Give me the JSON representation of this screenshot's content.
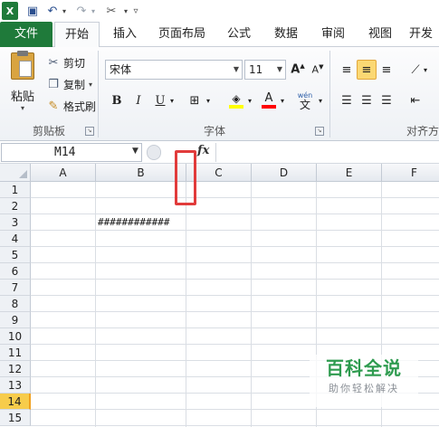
{
  "tabs": [
    "文件",
    "开始",
    "插入",
    "页面布局",
    "公式",
    "数据",
    "审阅",
    "视图",
    "开发"
  ],
  "clipboard": {
    "paste": "粘贴",
    "cut": "剪切",
    "copy": "复制",
    "format_painter": "格式刷",
    "group_label": "剪贴板"
  },
  "font": {
    "name": "宋体",
    "size": "11",
    "group_label": "字体",
    "fill_color": "#ffff00",
    "font_color": "#ff0000"
  },
  "alignment": {
    "group_label": "对齐方"
  },
  "formula_bar": {
    "name_box": "M14",
    "fx": "fx"
  },
  "grid": {
    "columns": [
      "A",
      "B",
      "C",
      "D",
      "E",
      "F"
    ],
    "rows": [
      "1",
      "2",
      "3",
      "4",
      "5",
      "6",
      "7",
      "8",
      "9",
      "10",
      "11",
      "12",
      "13",
      "14",
      "15"
    ],
    "selected_row": "14",
    "cells": {
      "B3": "############"
    }
  },
  "watermark": {
    "title": "百科全说",
    "subtitle": "助你轻松解决"
  },
  "colors": {
    "file_tab": "#1f7a3a",
    "selected_row_header": "#f7cc4b",
    "highlight_box": "#e13b3b",
    "watermark_green": "#2e9b4f"
  }
}
